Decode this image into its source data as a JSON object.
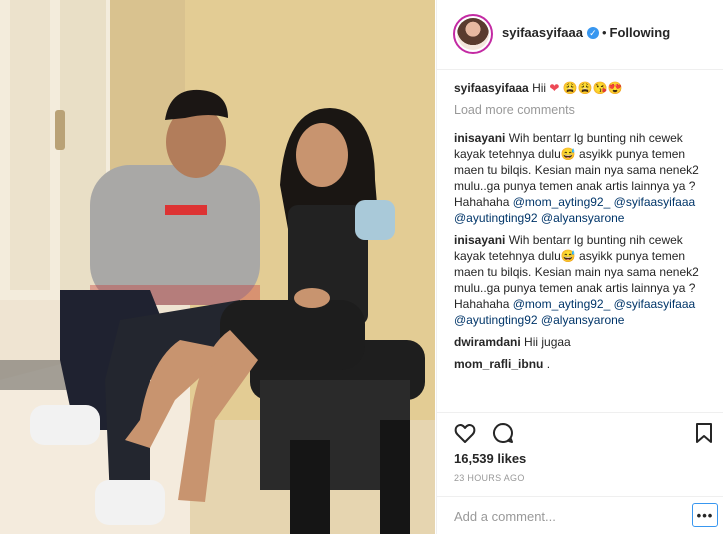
{
  "post": {
    "photo_alt": "",
    "author": "syifaasyifaaa",
    "separator": "•",
    "follow_status": "Following",
    "verified_glyph": "✓"
  },
  "caption": {
    "user": "syifaasyifaaa",
    "text": "Hii",
    "emojis": "❤",
    "emoji_faces": "😩😩😘😍"
  },
  "load_more": "Load more comments",
  "comments": [
    {
      "user": "inisayani",
      "text_a": "Wih bentarr lg bunting nih cewek kayak tetehnya dulu",
      "emoji": "😅",
      "text_b": " asyikk punya temen maen tu bilqis. Kesian main nya sama nenek2 mulu..ga punya temen anak artis lainnya ya ? Hahahaha ",
      "mention1": "@mom_ayting92_",
      "mention2": "@syifaasyifaaa",
      "mention3": "@ayutingting92",
      "mention4": "@alyansyarone"
    },
    {
      "user": "inisayani",
      "text_a": "Wih bentarr lg bunting nih cewek kayak tetehnya dulu",
      "emoji": "😅",
      "text_b": " asyikk punya temen maen tu bilqis. Kesian main nya sama nenek2 mulu..ga punya temen anak artis lainnya ya ? Hahahaha ",
      "mention1": "@mom_ayting92_",
      "mention2": "@syifaasyifaaa",
      "mention3": "@ayutingting92",
      "mention4": "@alyansyarone"
    }
  ],
  "short_comments": [
    {
      "user": "dwiramdani",
      "text": "Hii jugaa"
    },
    {
      "user": "mom_rafli_ibnu",
      "text": "."
    }
  ],
  "likes": "16,539 likes",
  "timestamp": "23 HOURS AGO",
  "add_comment_placeholder": "Add a comment...",
  "more_label": "•••",
  "icons": {
    "like": "heart-icon",
    "comment": "comment-bubble-icon",
    "save": "bookmark-icon",
    "more": "more-options-icon"
  }
}
